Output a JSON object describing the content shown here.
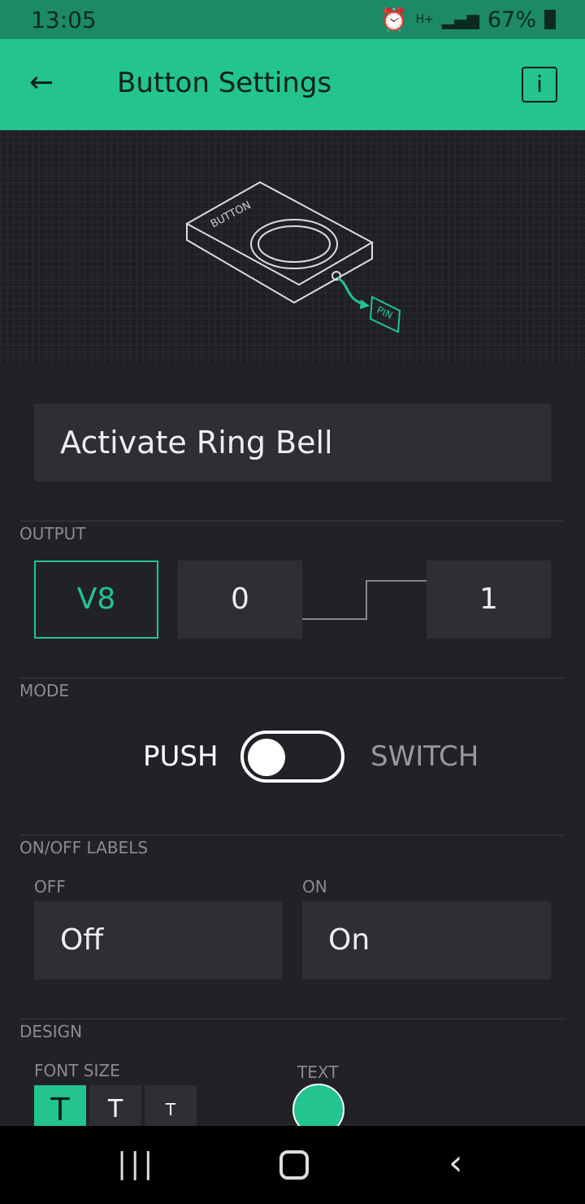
{
  "status": {
    "time": "13:05",
    "network": "H+",
    "battery": "67%"
  },
  "header": {
    "title": "Button Settings",
    "back_icon": "arrow-left-icon",
    "info_label": "i"
  },
  "illustration": {
    "device_label": "BUTTON",
    "pin_label": "PIN"
  },
  "name_field": {
    "value": "Activate Ring Bell"
  },
  "output": {
    "label": "OUTPUT",
    "pin": "V8",
    "low": "0",
    "high": "1"
  },
  "mode": {
    "label": "MODE",
    "push": "PUSH",
    "switch": "SWITCH",
    "selected": "PUSH"
  },
  "labels": {
    "label": "ON/OFF LABELS",
    "off_label": "OFF",
    "off_value": "Off",
    "on_label": "ON",
    "on_value": "On"
  },
  "design": {
    "label": "DESIGN",
    "font_size_label": "FONT SIZE",
    "font_sizes": [
      "T",
      "T",
      "T"
    ],
    "selected_font": 0,
    "text_label": "TEXT",
    "text_color": "#23c48e"
  },
  "colors": {
    "accent": "#23c48e"
  }
}
